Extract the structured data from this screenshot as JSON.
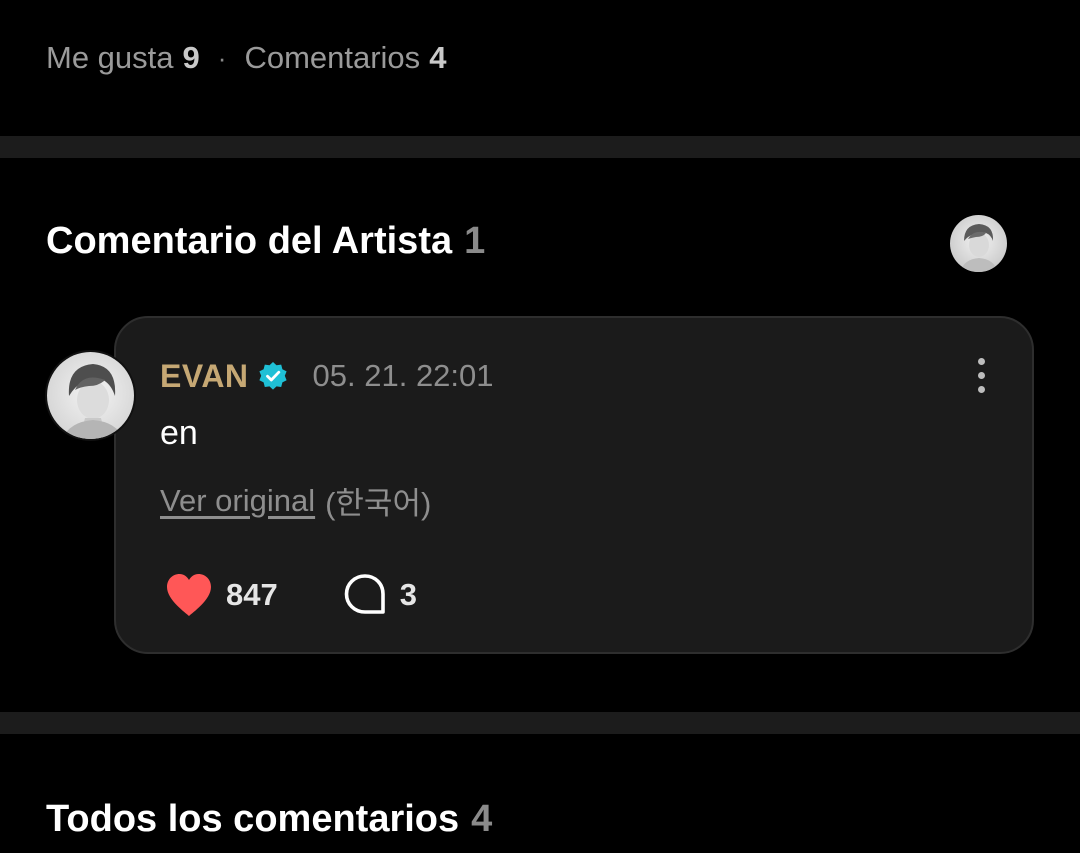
{
  "stats": {
    "likes_label": "Me gusta",
    "likes_count": "9",
    "separator": "·",
    "comments_label": "Comentarios",
    "comments_count": "4"
  },
  "artist_section": {
    "title": "Comentario del Artista",
    "count": "1",
    "avatar_icon": "artist-avatar-icon"
  },
  "artist_comment": {
    "author": "EVAN",
    "verified_icon": "verified-badge-icon",
    "verified_color": "#1fc0d6",
    "author_color": "#c6a874",
    "timestamp": "05. 21. 22:01",
    "body": "en",
    "translation_link": "Ver original",
    "translation_lang": "(한국어)",
    "likes": "847",
    "like_color": "#ff5757",
    "replies": "3"
  },
  "all_comments": {
    "title": "Todos los comentarios",
    "count": "4"
  }
}
